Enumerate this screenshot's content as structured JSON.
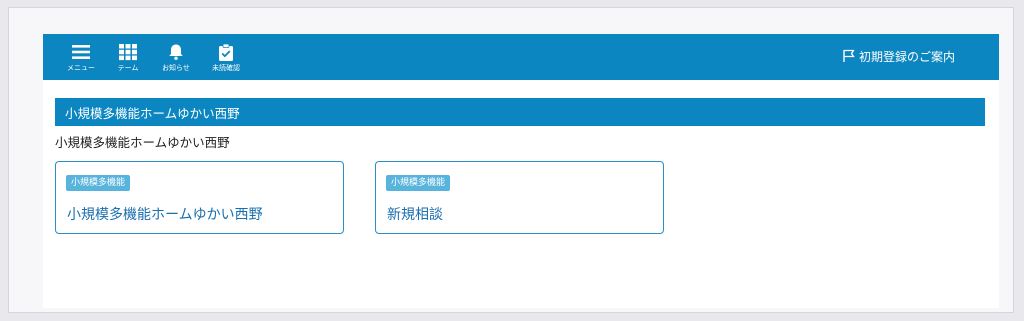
{
  "nav": {
    "items": [
      {
        "label": "メニュー",
        "icon": "hamburger-menu-icon"
      },
      {
        "label": "テーム",
        "icon": "grid-icon"
      },
      {
        "label": "お知らせ",
        "icon": "bell-icon"
      },
      {
        "label": "未読確認",
        "icon": "clipboard-check-icon"
      }
    ],
    "guide_label": "初期登録のご案内",
    "guide_icon": "flag-icon"
  },
  "section": {
    "title": "小規模多機能ホームゆかい西野",
    "subtitle": "小規模多機能ホームゆかい西野"
  },
  "cards": [
    {
      "badge": "小規模多機能",
      "title": "小規模多機能ホームゆかい西野"
    },
    {
      "badge": "小規模多機能",
      "title": "新規相談"
    }
  ],
  "colors": {
    "primary": "#0b86c1",
    "badge": "#58b4dc",
    "card_border": "#2a8ec9",
    "card_title": "#1a6fae"
  }
}
